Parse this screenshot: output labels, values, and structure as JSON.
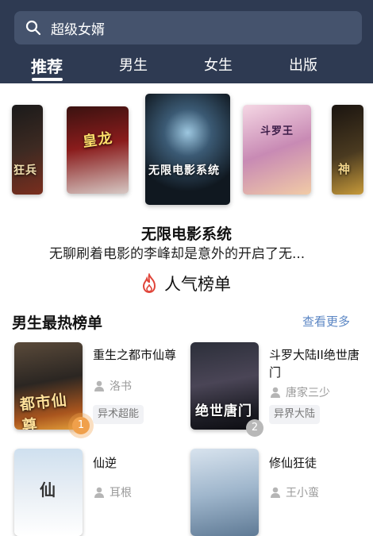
{
  "search": {
    "query": "超级女婿"
  },
  "tabs": [
    {
      "label": "推荐",
      "active": true
    },
    {
      "label": "男生"
    },
    {
      "label": "女生"
    },
    {
      "label": "出版"
    }
  ],
  "carousel": {
    "covers": [
      {
        "title": "狂兵"
      },
      {
        "title": "皇龙"
      },
      {
        "title": "无限电影系统"
      },
      {
        "title": "斗罗王"
      },
      {
        "title": "神"
      }
    ],
    "featured_title": "无限电影系统",
    "featured_desc": "无聊刷着电影的李峰却是意外的开启了无..."
  },
  "ranking": {
    "label": "人气榜单"
  },
  "section": {
    "title": "男生最热榜单",
    "more": "查看更多"
  },
  "books": [
    {
      "name": "重生之都市仙尊",
      "author": "洛书",
      "tag": "异术超能",
      "rank": "1",
      "cover_title": "都市仙尊"
    },
    {
      "name": "斗罗大陆II绝世唐门",
      "author": "唐家三少",
      "tag": "异界大陆",
      "rank": "2",
      "cover_title": "绝世唐门"
    },
    {
      "name": "仙逆",
      "author": "耳根",
      "cover_title": "仙"
    },
    {
      "name": "修仙狂徒",
      "author": "王小蛮"
    }
  ],
  "colors": {
    "header": "#2e3a52",
    "accent": "#5b86c4",
    "rank1": "#f0a04b",
    "rank2": "#b8b8b8"
  }
}
